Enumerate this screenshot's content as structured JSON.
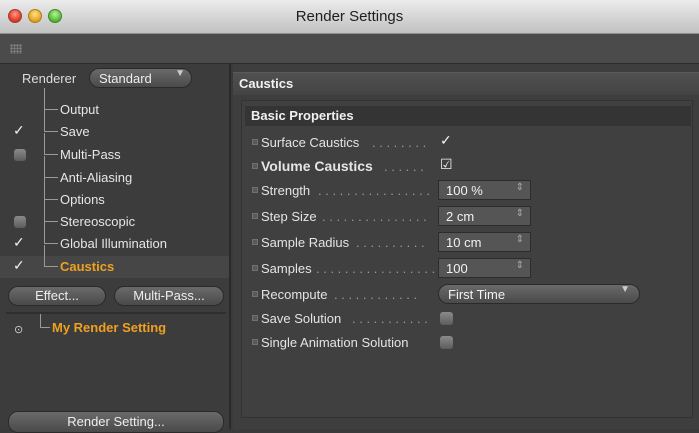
{
  "window": {
    "title": "Render Settings"
  },
  "left": {
    "renderer_label": "Renderer",
    "renderer_value": "Standard",
    "items": [
      {
        "label": "Output",
        "mark": "none"
      },
      {
        "label": "Save",
        "mark": "tick"
      },
      {
        "label": "Multi-Pass",
        "mark": "box"
      },
      {
        "label": "Anti-Aliasing",
        "mark": "none"
      },
      {
        "label": "Options",
        "mark": "none"
      },
      {
        "label": "Stereoscopic",
        "mark": "box"
      },
      {
        "label": "Global Illumination",
        "mark": "tick"
      },
      {
        "label": "Caustics",
        "mark": "tick",
        "selected": true
      }
    ],
    "effect_button": "Effect...",
    "multipass_button": "Multi-Pass...",
    "render_setting_name": "My Render Setting",
    "render_setting_button": "Render Setting..."
  },
  "right": {
    "section_title": "Caustics",
    "group_title": "Basic Properties",
    "properties": {
      "surface_caustics": {
        "label": "Surface Caustics",
        "dots": " . . . . . . . .",
        "checked": true
      },
      "volume_caustics": {
        "label": "Volume Caustics",
        "dots": " . . . . . .",
        "checked": true
      },
      "strength": {
        "label": "Strength",
        "dots": " . . . . . . . . . . . . . . . .",
        "value": "100 %"
      },
      "step_size": {
        "label": "Step Size",
        "dots": " . . . . . . . . . . . . . . .",
        "value": "2 cm"
      },
      "sample_radius": {
        "label": "Sample Radius",
        "dots": " . . . . . . . . . .",
        "value": "10 cm"
      },
      "samples": {
        "label": "Samples",
        "dots": " . . . . . . . . . . . . . . . . .",
        "value": "100"
      },
      "recompute": {
        "label": "Recompute",
        "dots": " . . . . . . . . . . . .",
        "value": "First Time"
      },
      "save_solution": {
        "label": "Save Solution",
        "dots": " . . . . . . . . . . .",
        "checked": false
      },
      "single_animation_solution": {
        "label": "Single Animation Solution",
        "checked": false
      }
    }
  },
  "colors": {
    "accent": "#f0a020",
    "panel": "#3c3c3c"
  },
  "icons": [
    "close-light",
    "minimize-light",
    "zoom-light",
    "checkmark-icon",
    "spin-arrows-icon",
    "dropdown-caret-icon"
  ]
}
